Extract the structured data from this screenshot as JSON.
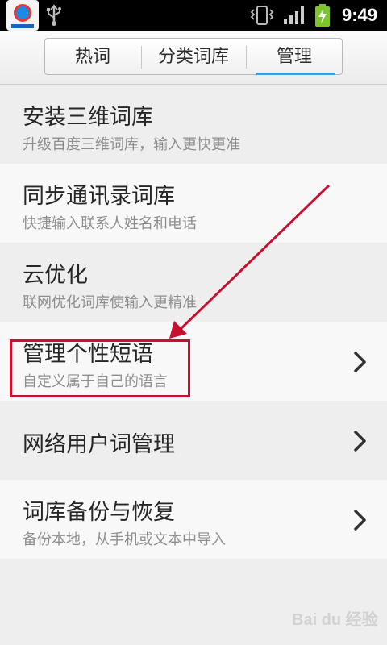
{
  "status_bar": {
    "time": "9:49",
    "icons": [
      "baidu-input-app-icon",
      "usb-icon",
      "vibrate-icon",
      "signal-icon",
      "battery-charging-icon"
    ]
  },
  "tabs": [
    {
      "label": "热词",
      "selected": false
    },
    {
      "label": "分类词库",
      "selected": false
    },
    {
      "label": "管理",
      "selected": true
    }
  ],
  "list": [
    {
      "title": "安装三维词库",
      "subtitle": "升级百度三维词库，输入更快更准",
      "chevron": false
    },
    {
      "title": "同步通讯录词库",
      "subtitle": "快捷输入联系人姓名和电话",
      "chevron": false
    },
    {
      "title": "云优化",
      "subtitle": "联网优化词库使输入更精准",
      "chevron": false
    },
    {
      "title": "管理个性短语",
      "subtitle": "自定义属于自己的语言",
      "chevron": true
    },
    {
      "title": "网络用户词管理",
      "subtitle": "",
      "chevron": true
    },
    {
      "title": "词库备份与恢复",
      "subtitle": "备份本地，从手机或文本中导入",
      "chevron": true
    }
  ],
  "colors": {
    "highlight": "#c8102e",
    "tab_accent": "#33a0e0"
  },
  "watermark": "Bai du 经验"
}
